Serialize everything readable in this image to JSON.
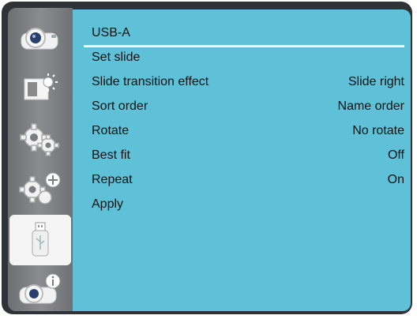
{
  "panel": {
    "title": "USB-A"
  },
  "sidebar": {
    "items": [
      {
        "name": "projector-icon"
      },
      {
        "name": "display-brightness-icon"
      },
      {
        "name": "gear-icon"
      },
      {
        "name": "gear-plus-icon"
      },
      {
        "name": "usb-drive-icon",
        "active": true
      },
      {
        "name": "projector-info-icon"
      }
    ]
  },
  "menu": [
    {
      "label": "Set slide",
      "value": ""
    },
    {
      "label": "Slide transition effect",
      "value": "Slide right"
    },
    {
      "label": "Sort order",
      "value": "Name order"
    },
    {
      "label": "Rotate",
      "value": "No rotate"
    },
    {
      "label": "Best fit",
      "value": "Off"
    },
    {
      "label": "Repeat",
      "value": "On"
    },
    {
      "label": "Apply",
      "value": ""
    }
  ],
  "colors": {
    "panel_bg": "#5ec1d8",
    "frame": "#2f3237",
    "sidebar": "#7b7d81",
    "active_tab": "#f5f5f5"
  }
}
